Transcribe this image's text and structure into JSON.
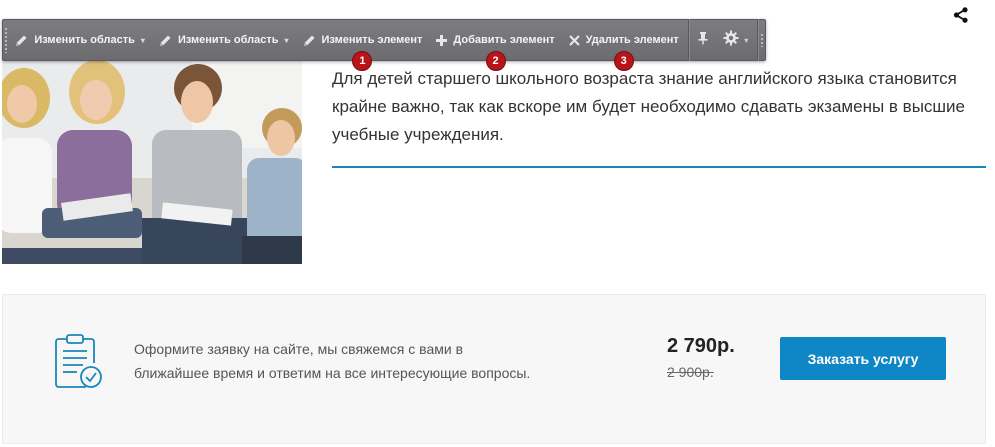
{
  "toolbar": {
    "items": [
      {
        "label": "Изменить область",
        "icon": "pencil-icon",
        "has_caret": true
      },
      {
        "label": "Изменить область",
        "icon": "pencil-icon",
        "has_caret": true
      },
      {
        "label": "Изменить элемент",
        "icon": "pencil-icon",
        "badge": "1"
      },
      {
        "label": "Добавить элемент",
        "icon": "plus-icon",
        "badge": "2"
      },
      {
        "label": "Удалить элемент",
        "icon": "close-icon",
        "badge": "3"
      }
    ],
    "badge_color": "#b8141a"
  },
  "content": {
    "intro_text": "Для детей старшего школьного возраста знание английского языка становится крайне важно, так как вскоре им будет необходимо сдавать экзамены в высшие учебные учреждения.",
    "accent_color": "#1a87b8"
  },
  "order": {
    "description": "Оформите заявку на сайте, мы свяжемся с вами в ближайшее время и ответим на все интересующие вопросы.",
    "price": "2 790р.",
    "old_price": "2 900р.",
    "button_label": "Заказать услугу",
    "button_color": "#0f86c6"
  }
}
